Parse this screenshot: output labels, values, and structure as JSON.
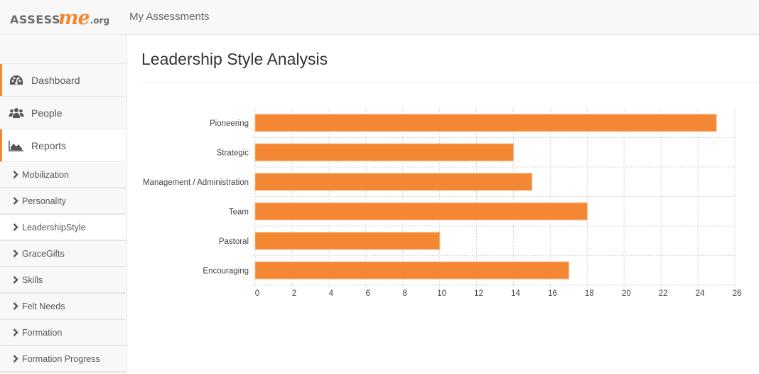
{
  "header": {
    "logo": {
      "part1": "ASSESS",
      "part2": "me",
      "part3": ".org"
    },
    "nav_link": "My Assessments"
  },
  "sidebar": {
    "items": [
      {
        "label": "Dashboard",
        "icon": "dashboard-icon"
      },
      {
        "label": "People",
        "icon": "people-icon"
      },
      {
        "label": "Reports",
        "icon": "area-chart-icon"
      }
    ],
    "sub_items": [
      {
        "label": "Mobilization"
      },
      {
        "label": "Personality"
      },
      {
        "label": "LeadershipStyle",
        "active": true
      },
      {
        "label": "GraceGifts"
      },
      {
        "label": "Skills"
      },
      {
        "label": "Felt Needs"
      },
      {
        "label": "Formation"
      },
      {
        "label": "Formation Progress"
      }
    ]
  },
  "page": {
    "title": "Leadership Style Analysis"
  },
  "colors": {
    "accent": "#f48831",
    "bar": "#f48734",
    "grid": "#d3d3d3"
  },
  "chart_data": {
    "type": "bar",
    "orientation": "horizontal",
    "title": "Leadership Style Analysis",
    "xlabel": "",
    "ylabel": "",
    "categories": [
      "Pioneering",
      "Strategic",
      "Management / Administration",
      "Team",
      "Pastoral",
      "Encouraging"
    ],
    "values": [
      25,
      14,
      15,
      18,
      10,
      17
    ],
    "xlim": [
      0,
      26
    ],
    "xticks": [
      0,
      2,
      4,
      6,
      8,
      10,
      12,
      14,
      16,
      18,
      20,
      22,
      24,
      26
    ],
    "grid": true,
    "legend": "none"
  }
}
